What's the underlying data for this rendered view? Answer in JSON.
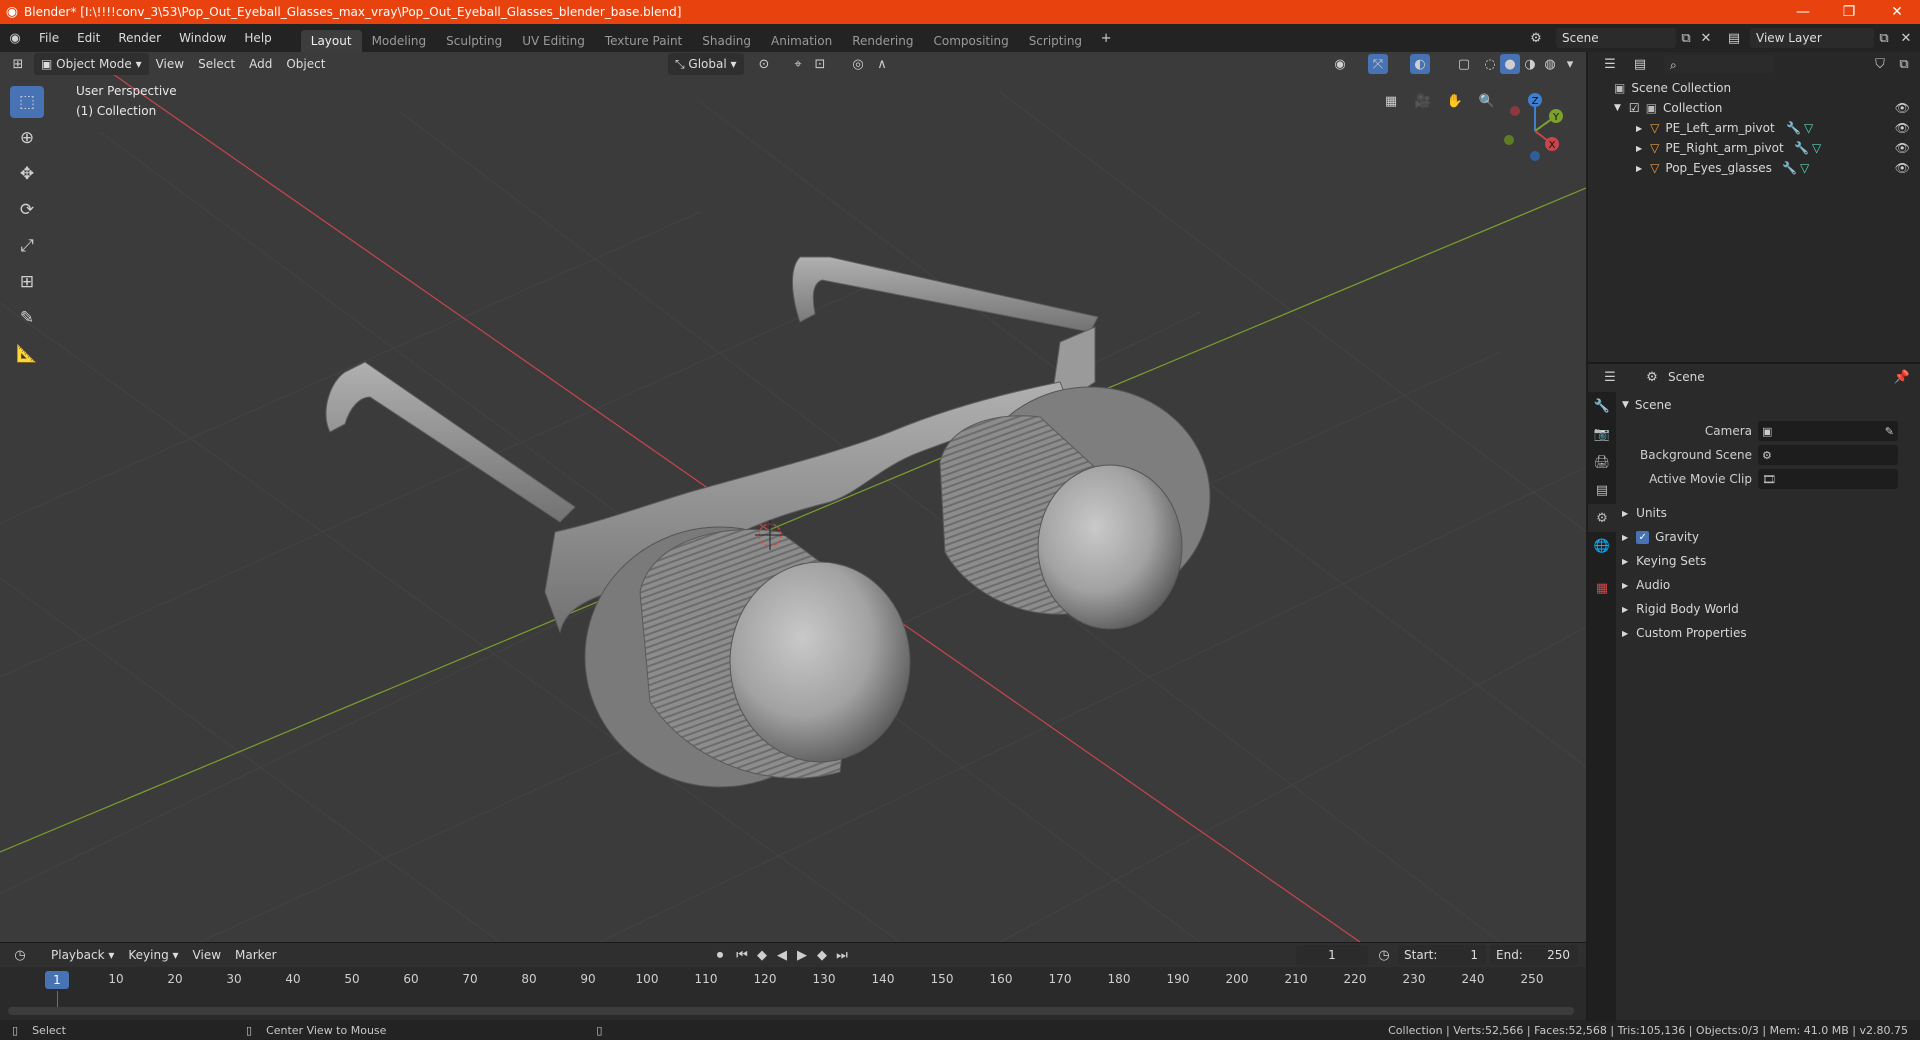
{
  "window": {
    "title": "Blender* [I:\\!!!!conv_3\\53\\Pop_Out_Eyeball_Glasses_max_vray\\Pop_Out_Eyeball_Glasses_blender_base.blend]",
    "minimize": "—",
    "maximize": "❐",
    "close": "✕"
  },
  "menu": [
    "File",
    "Edit",
    "Render",
    "Window",
    "Help"
  ],
  "workspaces": [
    "Layout",
    "Modeling",
    "Sculpting",
    "UV Editing",
    "Texture Paint",
    "Shading",
    "Animation",
    "Rendering",
    "Compositing",
    "Scripting"
  ],
  "scene_selector": "Scene",
  "view_layer": "View Layer",
  "viewport": {
    "mode": "Object Mode",
    "menus": [
      "View",
      "Select",
      "Add",
      "Object"
    ],
    "orientation": "Global",
    "overlay_line1": "User Perspective",
    "overlay_line2": "(1) Collection",
    "gizmo_axes": {
      "x": "X",
      "y": "Y",
      "z": "Z"
    }
  },
  "outliner": {
    "root": "Scene Collection",
    "collection": "Collection",
    "objects": [
      "PE_Left_arm_pivot",
      "PE_Right_arm_pivot",
      "Pop_Eyes_glasses"
    ]
  },
  "properties": {
    "header": "Scene",
    "panel": "Scene",
    "fields": [
      {
        "label": "Camera",
        "value": ""
      },
      {
        "label": "Background Scene",
        "value": ""
      },
      {
        "label": "Active Movie Clip",
        "value": ""
      }
    ],
    "sections": [
      "Units",
      "Gravity",
      "Keying Sets",
      "Audio",
      "Rigid Body World",
      "Custom Properties"
    ],
    "gravity_checked": true
  },
  "timeline": {
    "menus": [
      "Playback",
      "Keying",
      "View",
      "Marker"
    ],
    "current_frame": "1",
    "start_label": "Start:",
    "start": "1",
    "end_label": "End:",
    "end": "250",
    "ruler": [
      "10",
      "20",
      "30",
      "40",
      "50",
      "60",
      "70",
      "80",
      "90",
      "100",
      "110",
      "120",
      "130",
      "140",
      "150",
      "160",
      "170",
      "180",
      "190",
      "200",
      "210",
      "220",
      "230",
      "240",
      "250"
    ],
    "ruler_current": "1"
  },
  "statusbar": {
    "select": "Select",
    "center_view": "Center View to Mouse",
    "info": "Collection | Verts:52,566 | Faces:52,568 | Tris:105,136 | Objects:0/3 | Mem: 41.0 MB | v2.80.75"
  },
  "colors": {
    "accent": "#4772b3",
    "titlebar": "#e8430e",
    "axis_x": "#c8454e",
    "axis_y": "#7ba02c",
    "axis_z": "#3d7fd1"
  }
}
